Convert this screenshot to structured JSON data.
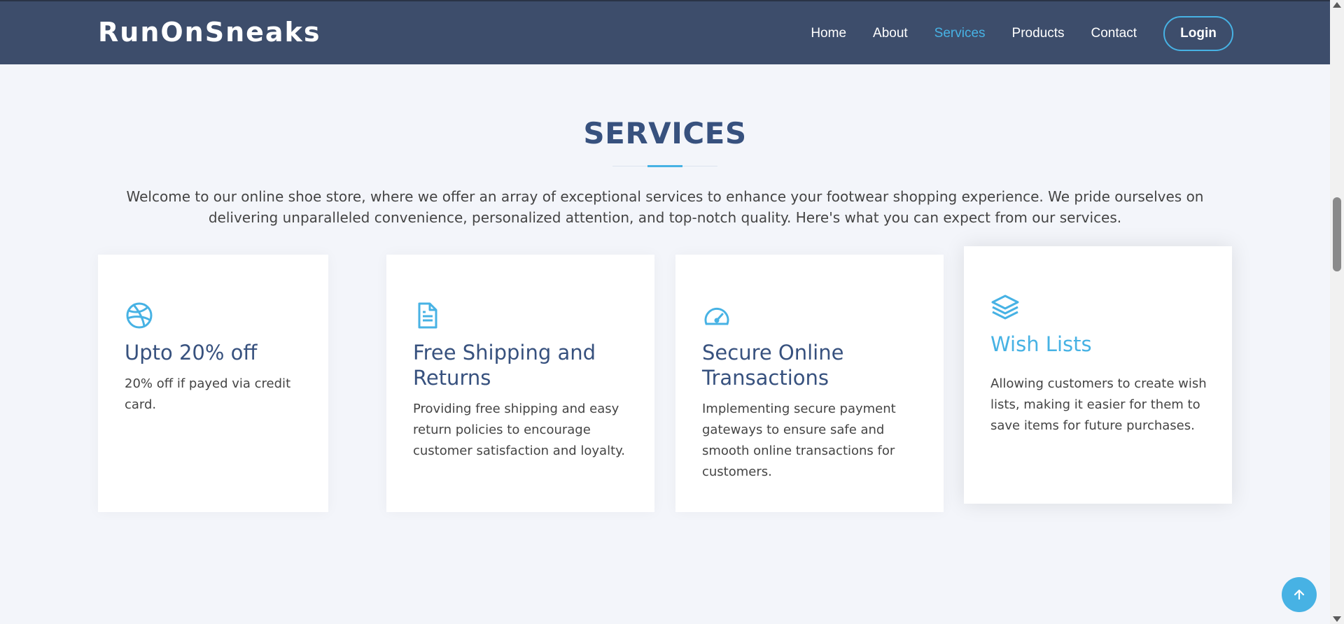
{
  "header": {
    "logo": "RunOnSneaks",
    "nav": [
      "Home",
      "About",
      "Services",
      "Products",
      "Contact"
    ],
    "active_nav": "Services",
    "login_label": "Login"
  },
  "section": {
    "title": "SERVICES",
    "intro": "Welcome to our online shoe store, where we offer an array of exceptional services to enhance your footwear shopping experience. We pride ourselves on delivering unparalleled convenience, personalized attention, and top-notch quality. Here's what you can expect from our services."
  },
  "cards": [
    {
      "icon": "dribbble-icon",
      "title": "Upto 20% off",
      "text": "20% off if payed via credit card."
    },
    {
      "icon": "document-icon",
      "title": "Free Shipping and Returns",
      "text": "Providing free shipping and easy return policies to encourage customer satisfaction and loyalty."
    },
    {
      "icon": "speedometer-icon",
      "title": "Secure Online Transactions",
      "text": "Implementing secure payment gateways to ensure safe and smooth online transactions for customers."
    },
    {
      "icon": "layers-icon",
      "title": "Wish Lists",
      "text": "Allowing customers to create wish lists, making it easier for them to save items for future purchases."
    }
  ],
  "colors": {
    "header_bg": "#3d4d6b",
    "accent": "#47b2e4",
    "heading": "#37517e",
    "page_bg": "#f3f5fa"
  }
}
